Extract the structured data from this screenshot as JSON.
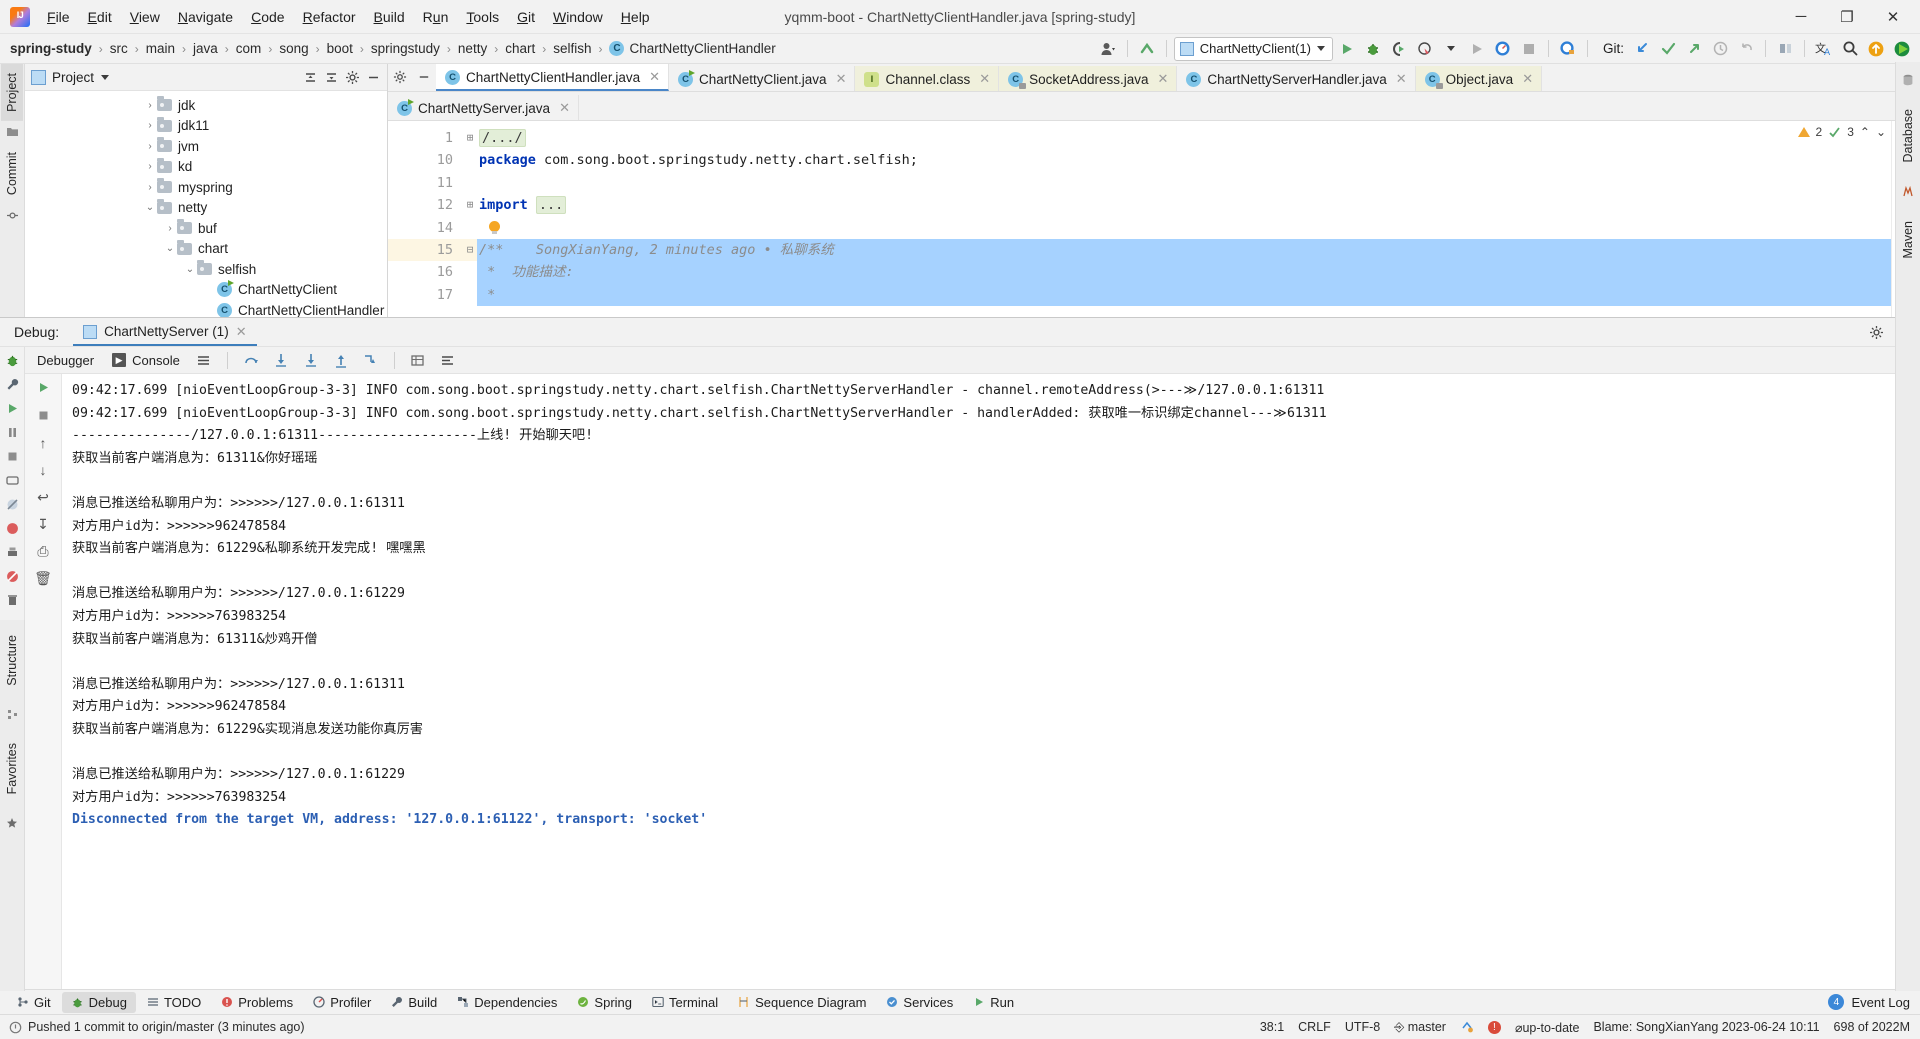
{
  "window": {
    "title": "yqmm-boot - ChartNettyClientHandler.java [spring-study]",
    "minimize": "─",
    "maximize": "❐",
    "close": "✕"
  },
  "menu": [
    {
      "label": "File"
    },
    {
      "label": "Edit"
    },
    {
      "label": "View"
    },
    {
      "label": "Navigate"
    },
    {
      "label": "Code"
    },
    {
      "label": "Refactor"
    },
    {
      "label": "Build"
    },
    {
      "label": "Run"
    },
    {
      "label": "Tools"
    },
    {
      "label": "Git"
    },
    {
      "label": "Window"
    },
    {
      "label": "Help"
    }
  ],
  "breadcrumb": {
    "items": [
      "spring-study",
      "src",
      "main",
      "java",
      "com",
      "song",
      "boot",
      "springstudy",
      "netty",
      "chart",
      "selfish"
    ],
    "final_class": "ChartNettyClientHandler",
    "separator": "›"
  },
  "toolbar": {
    "run_config": "ChartNettyClient(1)",
    "git_label": "Git:"
  },
  "project_panel": {
    "title": "Project",
    "tree": [
      {
        "label": "jdk",
        "arrow": "›",
        "depth": 2,
        "type": "folder"
      },
      {
        "label": "jdk11",
        "arrow": "›",
        "depth": 2,
        "type": "folder"
      },
      {
        "label": "jvm",
        "arrow": "›",
        "depth": 2,
        "type": "folder"
      },
      {
        "label": "kd",
        "arrow": "›",
        "depth": 2,
        "type": "folder"
      },
      {
        "label": "myspring",
        "arrow": "›",
        "depth": 2,
        "type": "folder"
      },
      {
        "label": "netty",
        "arrow": "⌄",
        "depth": 2,
        "type": "folder"
      },
      {
        "label": "buf",
        "arrow": "›",
        "depth": 3,
        "type": "folder"
      },
      {
        "label": "chart",
        "arrow": "⌄",
        "depth": 3,
        "type": "folder"
      },
      {
        "label": "selfish",
        "arrow": "⌄",
        "depth": 4,
        "type": "folder"
      },
      {
        "label": "ChartNettyClient",
        "arrow": "",
        "depth": 5,
        "type": "class"
      },
      {
        "label": "ChartNettyClientHandler",
        "arrow": "",
        "depth": 5,
        "type": "class"
      }
    ]
  },
  "editor": {
    "tabs_row1": [
      {
        "label": "ChartNettyClientHandler.java",
        "icon": "java-class-icon",
        "active": true,
        "library": false
      },
      {
        "label": "ChartNettyClient.java",
        "icon": "java-runnable-class-icon",
        "active": false,
        "library": false
      },
      {
        "label": "Channel.class",
        "icon": "java-interface-icon",
        "active": false,
        "library": true
      },
      {
        "label": "SocketAddress.java",
        "icon": "java-readonly-class-icon",
        "active": false,
        "library": true
      },
      {
        "label": "ChartNettyServerHandler.java",
        "icon": "java-class-icon",
        "active": false,
        "library": false
      },
      {
        "label": "Object.java",
        "icon": "java-readonly-class-icon",
        "active": false,
        "library": true
      }
    ],
    "tabs_row2": [
      {
        "label": "ChartNettyServer.java",
        "icon": "java-runnable-class-icon",
        "active": false,
        "library": false
      }
    ],
    "inspection": {
      "warnings": "2",
      "checks": "3"
    },
    "lines": [
      {
        "num": "1",
        "fold": "⊞",
        "text": "/.../",
        "style": "fold"
      },
      {
        "num": "10",
        "fold": "",
        "text": "package com.song.boot.springstudy.netty.chart.selfish;",
        "style": "package"
      },
      {
        "num": "11",
        "fold": "",
        "text": "",
        "style": "plain"
      },
      {
        "num": "12",
        "fold": "⊞",
        "text": "import ...",
        "style": "import"
      },
      {
        "num": "14",
        "fold": "",
        "text": "",
        "style": "bulb"
      },
      {
        "num": "15",
        "fold": "⊟",
        "text": "/**    SongXianYang, 2 minutes ago • 私聊系统",
        "style": "annotated"
      },
      {
        "num": "16",
        "fold": "",
        "text": " *  功能描述:",
        "style": "annotated"
      },
      {
        "num": "17",
        "fold": "",
        "text": " *",
        "style": "annotated"
      }
    ]
  },
  "debug": {
    "header_label": "Debug:",
    "session_tab": "ChartNettyServer (1)",
    "toolbar": {
      "debugger_tab": "Debugger",
      "console_tab": "Console"
    },
    "console_lines": [
      {
        "text": "09:42:17.699 [nioEventLoopGroup-3-3] INFO com.song.boot.springstudy.netty.chart.selfish.ChartNettyServerHandler - channel.remoteAddress(>---≫/127.0.0.1:61311",
        "type": "clipped"
      },
      {
        "text": "09:42:17.699 [nioEventLoopGroup-3-3] INFO com.song.boot.springstudy.netty.chart.selfish.ChartNettyServerHandler - handlerAdded: 获取唯一标识绑定channel---≫61311",
        "type": "normal"
      },
      {
        "text": "---------------/127.0.0.1:61311--------------------上线! 开始聊天吧!",
        "type": "normal"
      },
      {
        "text": "获取当前客户端消息为：61311&你好瑶瑶",
        "type": "normal"
      },
      {
        "text": "",
        "type": "blank"
      },
      {
        "text": "消息已推送给私聊用户为：>>>>>>/127.0.0.1:61311",
        "type": "normal"
      },
      {
        "text": "对方用户id为：>>>>>>962478584",
        "type": "normal"
      },
      {
        "text": "获取当前客户端消息为：61229&私聊系统开发完成! 嘿嘿黑",
        "type": "normal"
      },
      {
        "text": "",
        "type": "blank"
      },
      {
        "text": "消息已推送给私聊用户为：>>>>>>/127.0.0.1:61229",
        "type": "normal"
      },
      {
        "text": "对方用户id为：>>>>>>763983254",
        "type": "normal"
      },
      {
        "text": "获取当前客户端消息为：61311&炒鸡开僧",
        "type": "normal"
      },
      {
        "text": "",
        "type": "blank"
      },
      {
        "text": "消息已推送给私聊用户为：>>>>>>/127.0.0.1:61311",
        "type": "normal"
      },
      {
        "text": "对方用户id为：>>>>>>962478584",
        "type": "normal"
      },
      {
        "text": "获取当前客户端消息为：61229&实现消息发送功能你真厉害",
        "type": "normal"
      },
      {
        "text": "",
        "type": "blank"
      },
      {
        "text": "消息已推送给私聊用户为：>>>>>>/127.0.0.1:61229",
        "type": "normal"
      },
      {
        "text": "对方用户id为：>>>>>>763983254",
        "type": "normal"
      },
      {
        "text": "Disconnected from the target VM, address: '127.0.0.1:61122', transport: 'socket'",
        "type": "link"
      }
    ]
  },
  "left_toolwindows": [
    {
      "label": "Project",
      "active": true
    },
    {
      "label": "Commit",
      "active": false
    }
  ],
  "left_toolwindows_bottom": [
    {
      "label": "Structure",
      "active": false
    },
    {
      "label": "Favorites",
      "active": false
    }
  ],
  "right_toolwindows": [
    {
      "label": "Database"
    },
    {
      "label": "Maven"
    }
  ],
  "bottom_tabs": [
    {
      "label": "Git",
      "icon": "git-icon",
      "active": false
    },
    {
      "label": "Debug",
      "icon": "bug-icon",
      "active": true
    },
    {
      "label": "TODO",
      "icon": "todo-icon",
      "active": false
    },
    {
      "label": "Problems",
      "icon": "problems-icon",
      "active": false
    },
    {
      "label": "Profiler",
      "icon": "profiler-icon",
      "active": false
    },
    {
      "label": "Build",
      "icon": "build-icon",
      "active": false
    },
    {
      "label": "Dependencies",
      "icon": "dependencies-icon",
      "active": false
    },
    {
      "label": "Spring",
      "icon": "spring-icon",
      "active": false
    },
    {
      "label": "Terminal",
      "icon": "terminal-icon",
      "active": false
    },
    {
      "label": "Sequence Diagram",
      "icon": "sequence-diagram-icon",
      "active": false
    },
    {
      "label": "Services",
      "icon": "services-icon",
      "active": false
    },
    {
      "label": "Run",
      "icon": "run-icon",
      "active": false
    }
  ],
  "bottom_right": {
    "event_log": "Event Log",
    "event_count": "4"
  },
  "statusbar": {
    "message": "Pushed 1 commit to origin/master (3 minutes ago)",
    "caret": "38:1",
    "line_sep": "CRLF",
    "encoding": "UTF-8",
    "branch": "master",
    "vcs_status": "⌀up-to-date",
    "blame": "Blame: SongXianYang 2023-06-24 10:11",
    "memory": "698 of 2022M"
  }
}
